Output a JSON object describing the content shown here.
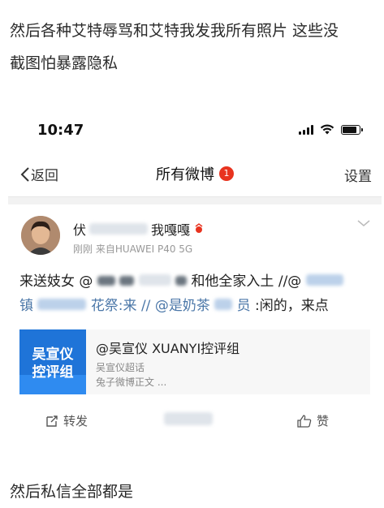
{
  "post": {
    "intro_line1": "然后各种艾特辱骂和艾特我发我所有照片 这些没",
    "intro_line2": "截图怕暴露隐私",
    "outro": "然后私信全部都是"
  },
  "phone": {
    "time": "10:47",
    "nav": {
      "back_label": "返回",
      "title": "所有微博",
      "badge_count": "1",
      "settings_label": "设置"
    },
    "card": {
      "author_prefix": "伏",
      "author_suffix": "我嘎嘎",
      "meta": "刚刚  来自HUAWEI P40 5G",
      "line1_a": "来送妓女 @",
      "line1_b": "和他全家入土 //@",
      "line2_a": "镇",
      "line2_b": "花祭:来 //",
      "line2_c": "@是奶茶",
      "line2_d": "员",
      "line2_e": ":闲的，来点",
      "embed_title": "@吴宣仪 XUANYI控评组",
      "embed_sub1": "吴宣仪超话",
      "embed_sub2": "兔子微博正文 ...",
      "embed_thumb_line1": "吴宣仪",
      "embed_thumb_line2": "控评组",
      "repost_label": "转发",
      "like_label": "赞"
    }
  }
}
